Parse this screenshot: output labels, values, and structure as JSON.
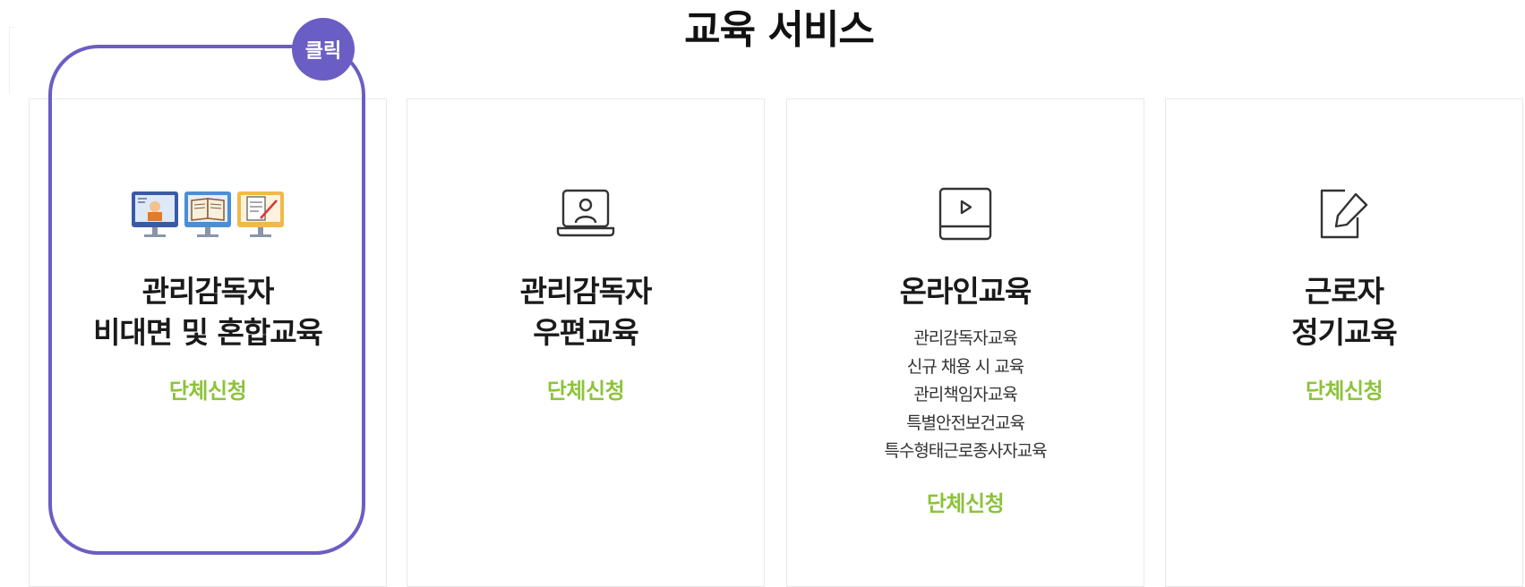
{
  "page": {
    "title": "교육 서비스"
  },
  "badge": {
    "label": "클릭",
    "color": "#6a5ec4"
  },
  "accent_color": "#8cc33a",
  "cards": [
    {
      "icon": "monitors-illustration-icon",
      "title_lines": [
        "관리감독자",
        "비대면 및 혼합교육"
      ],
      "apply_label": "단체신청",
      "highlighted": true
    },
    {
      "icon": "laptop-user-icon",
      "title_lines": [
        "관리감독자",
        "우편교육"
      ],
      "apply_label": "단체신청"
    },
    {
      "icon": "video-play-icon",
      "title_lines": [
        "온라인교육"
      ],
      "courses": [
        "관리감독자교육",
        "신규 채용 시 교육",
        "관리책임자교육",
        "특별안전보건교육",
        "특수형태근로종사자교육"
      ],
      "apply_label": "단체신청"
    },
    {
      "icon": "edit-note-icon",
      "title_lines": [
        "근로자",
        "정기교육"
      ],
      "apply_label": "단체신청"
    }
  ]
}
